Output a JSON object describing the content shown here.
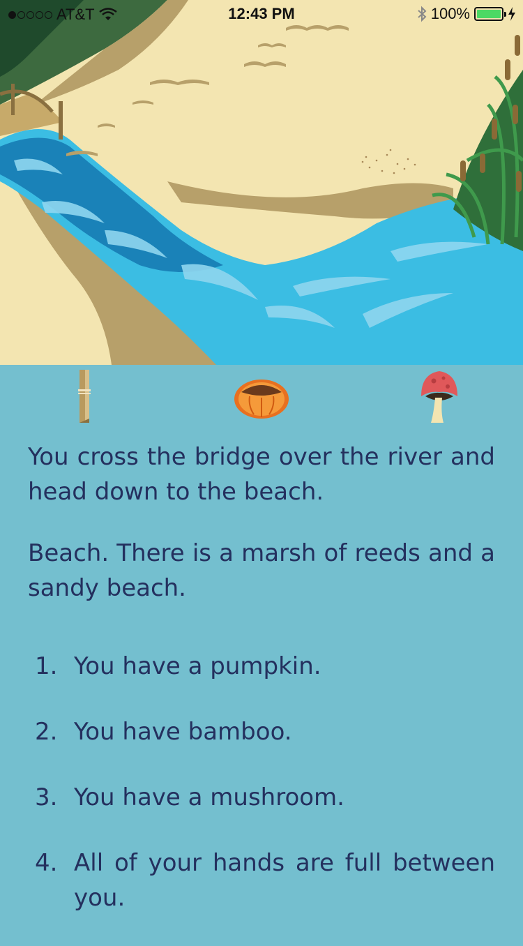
{
  "status_bar": {
    "carrier": "AT&T",
    "time": "12:43 PM",
    "battery": "100%"
  },
  "inventory": [
    {
      "icon": "bamboo-icon"
    },
    {
      "icon": "pumpkin-icon"
    },
    {
      "icon": "mushroom-icon"
    }
  ],
  "story": {
    "paragraphs": [
      "You cross the bridge over the river and head down to the beach.",
      "Beach. There is a marsh of reeds and a sandy beach."
    ],
    "list": [
      {
        "number": "1.",
        "text": "You have a pumpkin."
      },
      {
        "number": "2.",
        "text": "You have bamboo."
      },
      {
        "number": "3.",
        "text": "You have a mushroom."
      },
      {
        "number": "4.",
        "text": "All of your hands are full between you."
      }
    ]
  },
  "colors": {
    "background": "#74bfcf",
    "text": "#24305e",
    "sand": "#f3e5b1",
    "river": "#2ea3d4"
  }
}
